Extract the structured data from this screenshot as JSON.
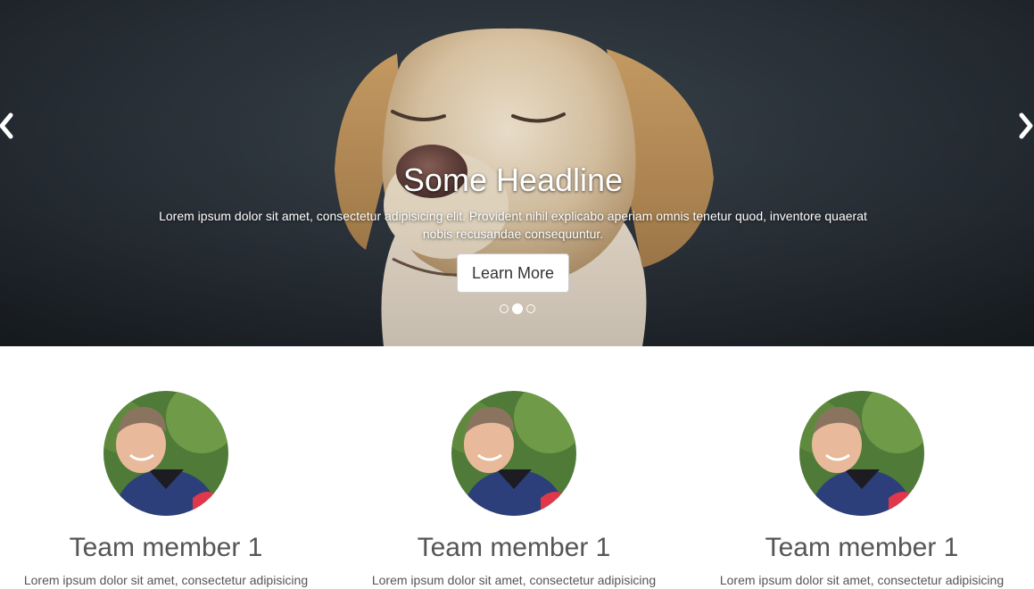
{
  "carousel": {
    "headline": "Some Headline",
    "text": "Lorem ipsum dolor sit amet, consectetur adipisicing elit. Provident nihil explicabo aperiam omnis tenetur quod, inventore quaerat nobis recusandae consequuntur.",
    "button_label": "Learn More",
    "slide_count": 3,
    "active_slide": 2
  },
  "team": {
    "members": [
      {
        "name": "Team member 1",
        "text": "Lorem ipsum dolor sit amet, consectetur adipisicing"
      },
      {
        "name": "Team member 1",
        "text": "Lorem ipsum dolor sit amet, consectetur adipisicing"
      },
      {
        "name": "Team member 1",
        "text": "Lorem ipsum dolor sit amet, consectetur adipisicing"
      }
    ]
  },
  "colors": {
    "hero_bg": "#262d34",
    "button_bg": "#ffffff",
    "text_gray": "#555555"
  },
  "icons": {
    "prev": "chevron-left-icon",
    "next": "chevron-right-icon"
  }
}
